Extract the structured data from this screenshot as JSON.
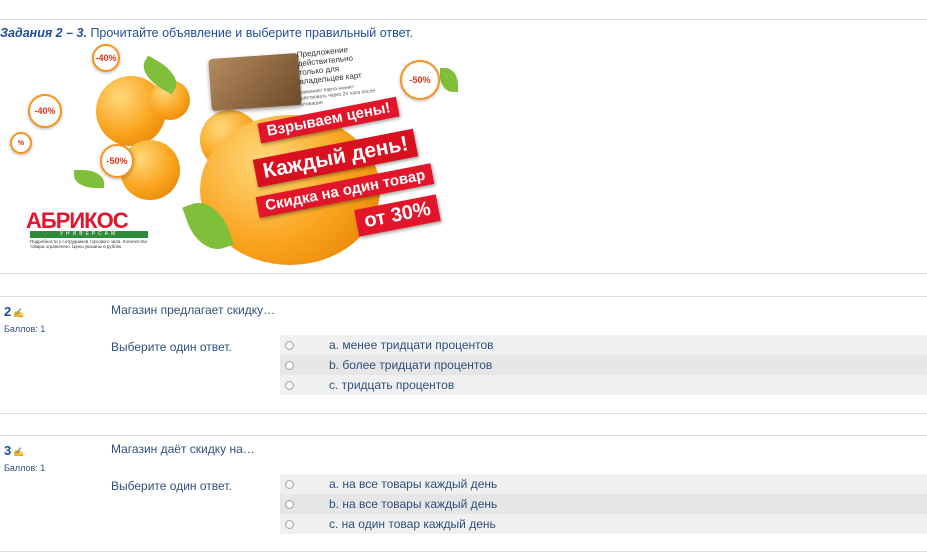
{
  "task": {
    "heading_prefix": "Задания 2 – 3.",
    "heading_text": " Прочитайте объявление и выберите правильный ответ."
  },
  "banner": {
    "card_note": "Предложение действительно только для владельцев карт",
    "card_fine": "Внимание! Карта начнёт действовать через 24 часа после активации",
    "stripe1": "Взрываем цены!",
    "stripe2": "Каждый день!",
    "stripe3": "Скидка на один товар",
    "stripe4": "от 30%",
    "tags": [
      "-40%",
      "-40%",
      "-50%",
      "-50%",
      "%"
    ],
    "logo": "АБРИКОС",
    "logo_sub": "УНИВЕРСАМ",
    "logo_fine": "Подробности у сотрудников торгового зала. Количество товара ограничено. Цены указаны в рублях."
  },
  "questions": [
    {
      "number": "2",
      "points": "Баллов: 1",
      "text": "Магазин предлагает скидку…",
      "prompt": "Выберите один ответ.",
      "answers": [
        "a. менее тридцати процентов",
        "b. более тридцати процентов",
        "c. тридцать процентов"
      ]
    },
    {
      "number": "3",
      "points": "Баллов: 1",
      "text": "Магазин даёт скидку на…",
      "prompt": "Выберите один ответ.",
      "answers": [
        "a. на все товары каждый день",
        "b. на все товары каждый день",
        "c. на один товар каждый день"
      ]
    }
  ]
}
